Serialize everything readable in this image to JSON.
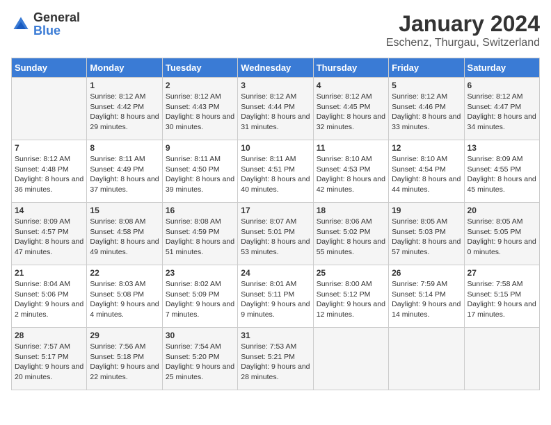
{
  "logo": {
    "general": "General",
    "blue": "Blue"
  },
  "title": {
    "month_year": "January 2024",
    "location": "Eschenz, Thurgau, Switzerland"
  },
  "days_of_week": [
    "Sunday",
    "Monday",
    "Tuesday",
    "Wednesday",
    "Thursday",
    "Friday",
    "Saturday"
  ],
  "weeks": [
    [
      {
        "day": "",
        "sunrise": "",
        "sunset": "",
        "daylight": ""
      },
      {
        "day": "1",
        "sunrise": "Sunrise: 8:12 AM",
        "sunset": "Sunset: 4:42 PM",
        "daylight": "Daylight: 8 hours and 29 minutes."
      },
      {
        "day": "2",
        "sunrise": "Sunrise: 8:12 AM",
        "sunset": "Sunset: 4:43 PM",
        "daylight": "Daylight: 8 hours and 30 minutes."
      },
      {
        "day": "3",
        "sunrise": "Sunrise: 8:12 AM",
        "sunset": "Sunset: 4:44 PM",
        "daylight": "Daylight: 8 hours and 31 minutes."
      },
      {
        "day": "4",
        "sunrise": "Sunrise: 8:12 AM",
        "sunset": "Sunset: 4:45 PM",
        "daylight": "Daylight: 8 hours and 32 minutes."
      },
      {
        "day": "5",
        "sunrise": "Sunrise: 8:12 AM",
        "sunset": "Sunset: 4:46 PM",
        "daylight": "Daylight: 8 hours and 33 minutes."
      },
      {
        "day": "6",
        "sunrise": "Sunrise: 8:12 AM",
        "sunset": "Sunset: 4:47 PM",
        "daylight": "Daylight: 8 hours and 34 minutes."
      }
    ],
    [
      {
        "day": "7",
        "sunrise": "Sunrise: 8:12 AM",
        "sunset": "Sunset: 4:48 PM",
        "daylight": "Daylight: 8 hours and 36 minutes."
      },
      {
        "day": "8",
        "sunrise": "Sunrise: 8:11 AM",
        "sunset": "Sunset: 4:49 PM",
        "daylight": "Daylight: 8 hours and 37 minutes."
      },
      {
        "day": "9",
        "sunrise": "Sunrise: 8:11 AM",
        "sunset": "Sunset: 4:50 PM",
        "daylight": "Daylight: 8 hours and 39 minutes."
      },
      {
        "day": "10",
        "sunrise": "Sunrise: 8:11 AM",
        "sunset": "Sunset: 4:51 PM",
        "daylight": "Daylight: 8 hours and 40 minutes."
      },
      {
        "day": "11",
        "sunrise": "Sunrise: 8:10 AM",
        "sunset": "Sunset: 4:53 PM",
        "daylight": "Daylight: 8 hours and 42 minutes."
      },
      {
        "day": "12",
        "sunrise": "Sunrise: 8:10 AM",
        "sunset": "Sunset: 4:54 PM",
        "daylight": "Daylight: 8 hours and 44 minutes."
      },
      {
        "day": "13",
        "sunrise": "Sunrise: 8:09 AM",
        "sunset": "Sunset: 4:55 PM",
        "daylight": "Daylight: 8 hours and 45 minutes."
      }
    ],
    [
      {
        "day": "14",
        "sunrise": "Sunrise: 8:09 AM",
        "sunset": "Sunset: 4:57 PM",
        "daylight": "Daylight: 8 hours and 47 minutes."
      },
      {
        "day": "15",
        "sunrise": "Sunrise: 8:08 AM",
        "sunset": "Sunset: 4:58 PM",
        "daylight": "Daylight: 8 hours and 49 minutes."
      },
      {
        "day": "16",
        "sunrise": "Sunrise: 8:08 AM",
        "sunset": "Sunset: 4:59 PM",
        "daylight": "Daylight: 8 hours and 51 minutes."
      },
      {
        "day": "17",
        "sunrise": "Sunrise: 8:07 AM",
        "sunset": "Sunset: 5:01 PM",
        "daylight": "Daylight: 8 hours and 53 minutes."
      },
      {
        "day": "18",
        "sunrise": "Sunrise: 8:06 AM",
        "sunset": "Sunset: 5:02 PM",
        "daylight": "Daylight: 8 hours and 55 minutes."
      },
      {
        "day": "19",
        "sunrise": "Sunrise: 8:05 AM",
        "sunset": "Sunset: 5:03 PM",
        "daylight": "Daylight: 8 hours and 57 minutes."
      },
      {
        "day": "20",
        "sunrise": "Sunrise: 8:05 AM",
        "sunset": "Sunset: 5:05 PM",
        "daylight": "Daylight: 9 hours and 0 minutes."
      }
    ],
    [
      {
        "day": "21",
        "sunrise": "Sunrise: 8:04 AM",
        "sunset": "Sunset: 5:06 PM",
        "daylight": "Daylight: 9 hours and 2 minutes."
      },
      {
        "day": "22",
        "sunrise": "Sunrise: 8:03 AM",
        "sunset": "Sunset: 5:08 PM",
        "daylight": "Daylight: 9 hours and 4 minutes."
      },
      {
        "day": "23",
        "sunrise": "Sunrise: 8:02 AM",
        "sunset": "Sunset: 5:09 PM",
        "daylight": "Daylight: 9 hours and 7 minutes."
      },
      {
        "day": "24",
        "sunrise": "Sunrise: 8:01 AM",
        "sunset": "Sunset: 5:11 PM",
        "daylight": "Daylight: 9 hours and 9 minutes."
      },
      {
        "day": "25",
        "sunrise": "Sunrise: 8:00 AM",
        "sunset": "Sunset: 5:12 PM",
        "daylight": "Daylight: 9 hours and 12 minutes."
      },
      {
        "day": "26",
        "sunrise": "Sunrise: 7:59 AM",
        "sunset": "Sunset: 5:14 PM",
        "daylight": "Daylight: 9 hours and 14 minutes."
      },
      {
        "day": "27",
        "sunrise": "Sunrise: 7:58 AM",
        "sunset": "Sunset: 5:15 PM",
        "daylight": "Daylight: 9 hours and 17 minutes."
      }
    ],
    [
      {
        "day": "28",
        "sunrise": "Sunrise: 7:57 AM",
        "sunset": "Sunset: 5:17 PM",
        "daylight": "Daylight: 9 hours and 20 minutes."
      },
      {
        "day": "29",
        "sunrise": "Sunrise: 7:56 AM",
        "sunset": "Sunset: 5:18 PM",
        "daylight": "Daylight: 9 hours and 22 minutes."
      },
      {
        "day": "30",
        "sunrise": "Sunrise: 7:54 AM",
        "sunset": "Sunset: 5:20 PM",
        "daylight": "Daylight: 9 hours and 25 minutes."
      },
      {
        "day": "31",
        "sunrise": "Sunrise: 7:53 AM",
        "sunset": "Sunset: 5:21 PM",
        "daylight": "Daylight: 9 hours and 28 minutes."
      },
      {
        "day": "",
        "sunrise": "",
        "sunset": "",
        "daylight": ""
      },
      {
        "day": "",
        "sunrise": "",
        "sunset": "",
        "daylight": ""
      },
      {
        "day": "",
        "sunrise": "",
        "sunset": "",
        "daylight": ""
      }
    ]
  ]
}
